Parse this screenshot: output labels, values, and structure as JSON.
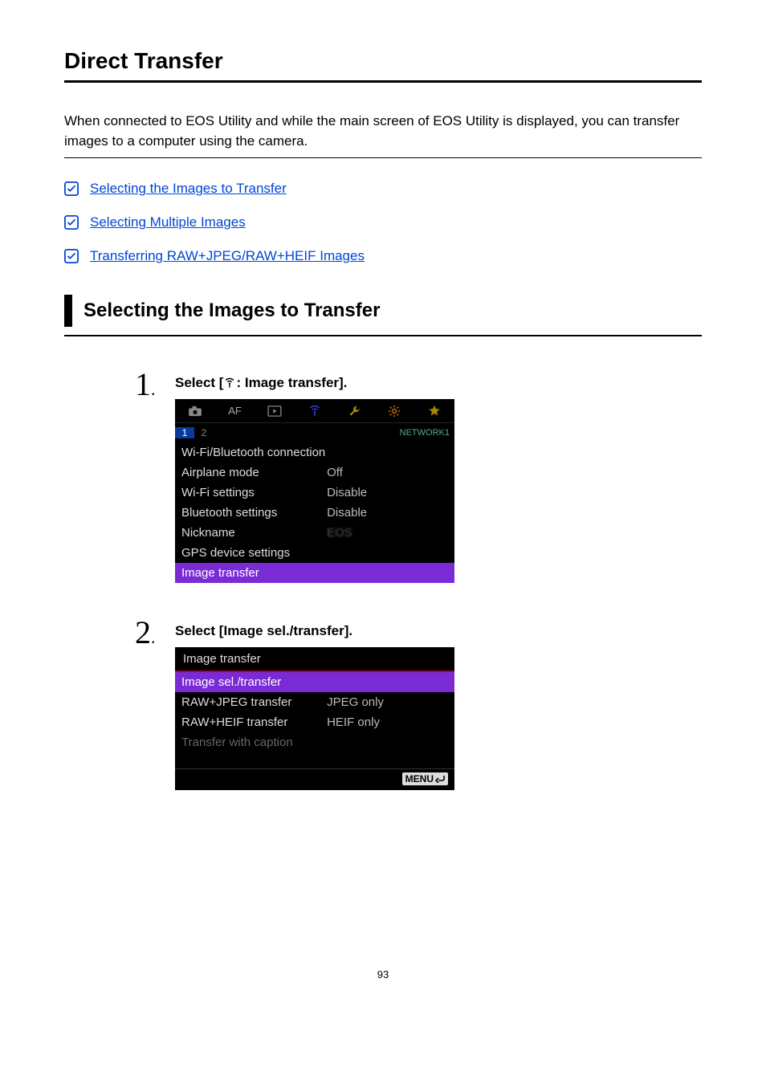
{
  "title": "Direct Transfer",
  "intro": "When connected to EOS Utility and while the main screen of EOS Utility is displayed, you can transfer images to a computer using the camera.",
  "toc": [
    {
      "label": "Selecting the Images to Transfer"
    },
    {
      "label": "Selecting Multiple Images"
    },
    {
      "label": "Transferring RAW+JPEG/RAW+HEIF Images"
    }
  ],
  "section_heading": "Selecting the Images to Transfer",
  "steps": [
    {
      "num": "1",
      "instruction_pre": "Select [",
      "instruction_post": ": Image transfer].",
      "screenshot": {
        "type": "top-menu",
        "tabs": [
          "camera",
          "AF",
          "play",
          "antenna",
          "wrench",
          "gear",
          "star"
        ],
        "active_tab_index": 3,
        "subtabs": [
          "1",
          "2"
        ],
        "active_subtab_index": 0,
        "subtab_right": "NETWORK1",
        "rows": [
          {
            "label": "Wi-Fi/Bluetooth connection",
            "value": ""
          },
          {
            "label": "Airplane mode",
            "value": "Off"
          },
          {
            "label": "Wi-Fi settings",
            "value": "Disable"
          },
          {
            "label": "Bluetooth settings",
            "value": "Disable"
          },
          {
            "label": "Nickname",
            "value": "EOS"
          },
          {
            "label": "GPS device settings",
            "value": ""
          },
          {
            "label": "Image transfer",
            "value": "",
            "highlight": true
          }
        ]
      }
    },
    {
      "num": "2",
      "instruction_full": "Select [Image sel./transfer].",
      "screenshot": {
        "type": "submenu",
        "title": "Image transfer",
        "rows": [
          {
            "label": "Image sel./transfer",
            "value": "",
            "highlight": true
          },
          {
            "label": "RAW+JPEG transfer",
            "value": "JPEG only"
          },
          {
            "label": "RAW+HEIF transfer",
            "value": "HEIF only"
          },
          {
            "label": "Transfer with caption",
            "value": "",
            "dimmed": true
          }
        ],
        "footer_button": "MENU"
      }
    }
  ],
  "page_number": "93"
}
